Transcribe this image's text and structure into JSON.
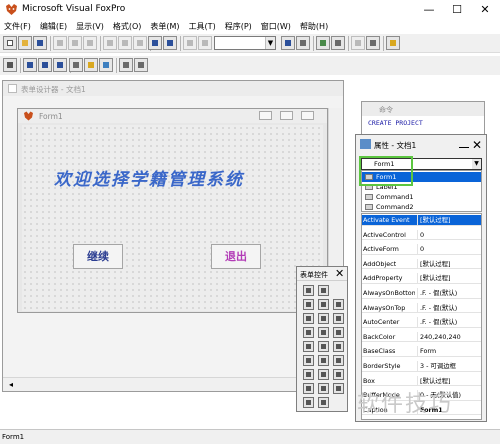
{
  "app": {
    "title": "Microsoft Visual FoxPro",
    "window_controls": [
      "—",
      "☐",
      "✕"
    ]
  },
  "menu": [
    "文件(F)",
    "编辑(E)",
    "显示(V)",
    "格式(O)",
    "表单(M)",
    "工具(T)",
    "程序(P)",
    "窗口(W)",
    "帮助(H)"
  ],
  "toolbar": {
    "combo_value": ""
  },
  "designer": {
    "title": "表单设计器 - 文档1",
    "form": {
      "title": "Form1",
      "heading": "欢迎选择学籍管理系统",
      "buttons": [
        "继续",
        "退出"
      ]
    }
  },
  "command_window": {
    "title": "命令",
    "text": "CREATE PROJECT"
  },
  "properties": {
    "title": "属性 - 文档1",
    "object_combo": "Form1",
    "objects": [
      "Form1",
      "Label1",
      "Command1",
      "Command2"
    ],
    "rows": [
      {
        "name": "Activate Event",
        "value": "[默认过程]"
      },
      {
        "name": "ActiveControl",
        "value": "0"
      },
      {
        "name": "ActiveForm",
        "value": "0"
      },
      {
        "name": "AddObject",
        "value": "[默认过程]"
      },
      {
        "name": "AddProperty",
        "value": "[默认过程]"
      },
      {
        "name": "AlwaysOnBottom",
        "value": ".F. - 假(默认)"
      },
      {
        "name": "AlwaysOnTop",
        "value": ".F. - 假(默认)"
      },
      {
        "name": "AutoCenter",
        "value": ".F. - 假(默认)"
      },
      {
        "name": "BackColor",
        "value": "240,240,240"
      },
      {
        "name": "BaseClass",
        "value": "Form"
      },
      {
        "name": "BorderStyle",
        "value": "3 - 可调边框"
      },
      {
        "name": "Box",
        "value": "[默认过程]"
      },
      {
        "name": "BufferMode",
        "value": "0 - 无(默认值)"
      },
      {
        "name": "Caption",
        "value": "Form1"
      }
    ]
  },
  "toolbox": {
    "title": "表单控件"
  },
  "status": {
    "text": "Form1"
  },
  "watermark": "软件技巧",
  "colors": {
    "heading": "#3a67c9",
    "selection": "#0a64d8",
    "highlight": "#5cc640"
  }
}
